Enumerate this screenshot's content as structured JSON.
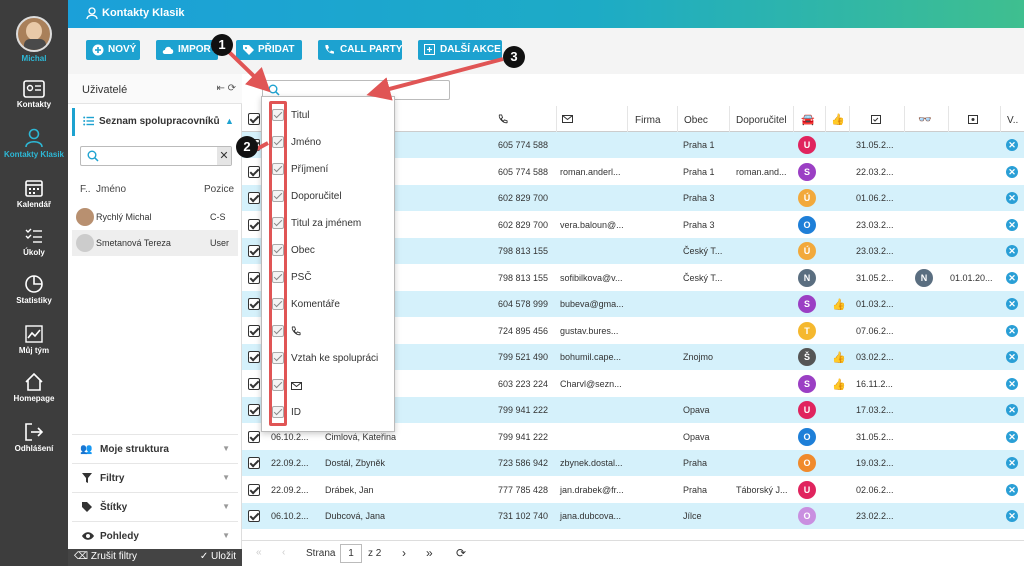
{
  "rail": {
    "user_name": "Michal",
    "items": [
      {
        "label": "Kontakty",
        "icon": "contacts-card-icon"
      },
      {
        "label": "Kontakty Klasik",
        "icon": "person-icon",
        "active": true
      },
      {
        "label": "Kalendář",
        "icon": "calendar-icon"
      },
      {
        "label": "Úkoly",
        "icon": "tasks-list-icon"
      },
      {
        "label": "Statistiky",
        "icon": "pie-chart-icon"
      },
      {
        "label": "Můj tým",
        "icon": "trend-chart-icon"
      },
      {
        "label": "Homepage",
        "icon": "home-icon"
      },
      {
        "label": "Odhlášení",
        "icon": "logout-icon"
      }
    ]
  },
  "header": {
    "title": "Kontakty Klasik"
  },
  "toolbar": {
    "new": "NOVÝ",
    "import": "IMPORT",
    "add": "PŘIDAT",
    "call_party": "CALL PARTY",
    "more": "DALŠÍ AKCE ..."
  },
  "left_panel": {
    "title": "Uživatelé",
    "section": "Seznam spolupracovníků",
    "col_f": "F..",
    "col_name": "Jméno",
    "col_position": "Pozice",
    "users": [
      {
        "name": "Rychlý Michal",
        "position": "C-S"
      },
      {
        "name": "Smetanová Tereza",
        "position": "User"
      }
    ],
    "accordions": [
      "Moje struktura",
      "Filtry",
      "Štítky",
      "Pohledy"
    ],
    "clear_filters": "Zrušit filtry",
    "save": "Uložit"
  },
  "columns_dropdown": {
    "items": [
      "Titul",
      "Jméno",
      "Příjmení",
      "Doporučitel",
      "Titul za jménem",
      "Obec",
      "PSČ",
      "Komentáře",
      "phone-icon",
      "Vztah ke spolupráci",
      "mail-icon",
      "ID"
    ]
  },
  "grid": {
    "headers": {
      "firma": "Firma",
      "obec": "Obec",
      "doporucitel": "Doporučitel",
      "last": "V.."
    },
    "rows": [
      {
        "date": "",
        "name": "",
        "phone": "605 774 588",
        "email": "",
        "obec": "Praha 1",
        "dop": "",
        "badge": "U",
        "color": "#e0245e",
        "thumb": false,
        "d1": "31.05.2...",
        "n": "",
        "d2": ""
      },
      {
        "date": "",
        "name": "",
        "phone": "605 774 588",
        "email": "roman.anderl...",
        "obec": "Praha 1",
        "dop": "roman.and...",
        "badge": "S",
        "color": "#9b3fc4",
        "thumb": false,
        "d1": "22.03.2...",
        "n": "",
        "d2": ""
      },
      {
        "date": "",
        "name": "",
        "phone": "602 829 700",
        "email": "",
        "obec": "Praha 3",
        "dop": "",
        "badge": "Ú",
        "color": "#f2a93b",
        "thumb": false,
        "d1": "01.06.2...",
        "n": "",
        "d2": ""
      },
      {
        "date": "",
        "name": "",
        "phone": "602 829 700",
        "email": "vera.baloun@...",
        "obec": "Praha 3",
        "dop": "",
        "badge": "O",
        "color": "#1e7fd8",
        "thumb": false,
        "d1": "23.03.2...",
        "n": "",
        "d2": ""
      },
      {
        "date": "",
        "name": "",
        "phone": "798 813 155",
        "email": "",
        "obec": "Český T...",
        "dop": "",
        "badge": "Ú",
        "color": "#f2a93b",
        "thumb": false,
        "d1": "23.03.2...",
        "n": "",
        "d2": ""
      },
      {
        "date": "",
        "name": "",
        "phone": "798 813 155",
        "email": "sofibilkova@v...",
        "obec": "Český T...",
        "dop": "",
        "badge": "N",
        "color": "#5a6e80",
        "thumb": false,
        "d1": "31.05.2...",
        "n": "N",
        "d2": "01.01.20..."
      },
      {
        "date": "",
        "name": "",
        "phone": "604 578 999",
        "email": "bubeva@gma...",
        "obec": "",
        "dop": "",
        "badge": "S",
        "color": "#9b3fc4",
        "thumb": true,
        "d1": "01.03.2...",
        "n": "",
        "d2": ""
      },
      {
        "date": "",
        "name": "",
        "phone": "724 895 456",
        "email": "gustav.bures...",
        "obec": "",
        "dop": "",
        "badge": "T",
        "color": "#f5b82e",
        "thumb": false,
        "d1": "07.06.2...",
        "n": "",
        "d2": ""
      },
      {
        "date": "",
        "name": "Bohumil",
        "phone": "799 521 490",
        "email": "bohumil.cape...",
        "obec": "Znojmo",
        "dop": "",
        "badge": "Š",
        "color": "#555555",
        "thumb": true,
        "d1": "03.02.2...",
        "n": "",
        "d2": ""
      },
      {
        "date": "",
        "name": "ír",
        "phone": "603 223 224",
        "email": "Charvl@sezn...",
        "obec": "",
        "dop": "",
        "badge": "S",
        "color": "#9b3fc4",
        "thumb": true,
        "d1": "16.11.2...",
        "n": "",
        "d2": ""
      },
      {
        "date": "",
        "name": "",
        "phone": "799 941 222",
        "email": "",
        "obec": "Opava",
        "dop": "",
        "badge": "U",
        "color": "#e0245e",
        "thumb": false,
        "d1": "17.03.2...",
        "n": "",
        "d2": ""
      },
      {
        "date": "06.10.2...",
        "name": "Cimlová, Kateřina",
        "phone": "799 941 222",
        "email": "",
        "obec": "Opava",
        "dop": "",
        "badge": "O",
        "color": "#1e7fd8",
        "thumb": false,
        "d1": "31.05.2...",
        "n": "",
        "d2": ""
      },
      {
        "date": "22.09.2...",
        "name": "Dostál, Zbyněk",
        "phone": "723 586 942",
        "email": "zbynek.dostal...",
        "obec": "Praha",
        "dop": "",
        "badge": "O",
        "color": "#f08a2c",
        "thumb": false,
        "d1": "19.03.2...",
        "n": "",
        "d2": ""
      },
      {
        "date": "22.09.2...",
        "name": "Drábek, Jan",
        "phone": "777 785 428",
        "email": "jan.drabek@fr...",
        "obec": "Praha",
        "dop": "Táborský J...",
        "badge": "U",
        "color": "#e0245e",
        "thumb": false,
        "d1": "02.06.2...",
        "n": "",
        "d2": ""
      },
      {
        "date": "06.10.2...",
        "name": "Dubcová, Jana",
        "phone": "731 102 740",
        "email": "jana.dubcova...",
        "obec": "Jílce",
        "dop": "",
        "badge": "O",
        "color": "#c98fe0",
        "thumb": false,
        "d1": "23.02.2...",
        "n": "",
        "d2": ""
      }
    ]
  },
  "pager": {
    "label": "Strana",
    "page": "1",
    "of": "z 2"
  },
  "callouts": [
    "1",
    "2",
    "3"
  ]
}
